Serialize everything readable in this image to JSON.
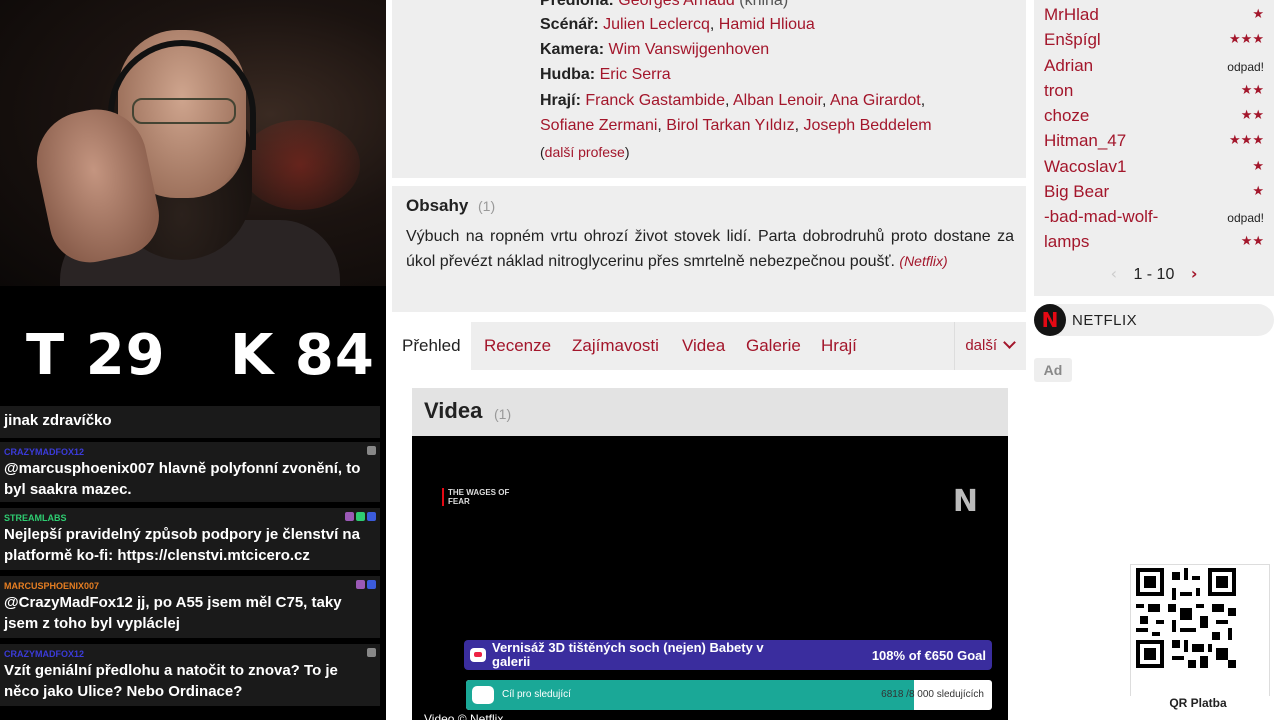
{
  "stream": {
    "score_t": "T 29",
    "score_k": "K 84",
    "chat": [
      {
        "user": "",
        "user_color": "#9b9b9b",
        "text": "jinak zdravíčko"
      },
      {
        "user": "CRAZYMADFOX12",
        "user_color": "#3b3bd9",
        "text": "@marcusphoenix007 hlavně polyfonní zvonění, to byl saakra mazec."
      },
      {
        "user": "STREAMLABS",
        "user_color": "#2ecc71",
        "text": "Nejlepší pravidelný způsob podpory je členství na platformě ko-fi: https://clenstvi.mtcicero.cz"
      },
      {
        "user": "MARCUSPHOENIX007",
        "user_color": "#e67e22",
        "text": "@CrazyMadFox12 jj, po A55 jsem měl C75, taky jsem z toho byl vypláclej"
      },
      {
        "user": "CRAZYMADFOX12",
        "user_color": "#3b3bd9",
        "text": "Vzít geniální předlohu a natočit to znova? To je něco jako Ulice? Nebo Ordinace?"
      }
    ],
    "goal": {
      "name": "Vernisáž 3D tištěných soch (nejen) Babety v galerii",
      "progress": "108% of €650 Goal",
      "progress_fraction": 1.0
    },
    "followers": {
      "label": "Cíl pro sledující",
      "count": "6818 /8 000 sledujících",
      "progress_fraction": 0.852
    }
  },
  "film": {
    "credits": [
      {
        "label": "Předloha:",
        "people": [
          "Georges Arnaud"
        ],
        "suffix": "(kniha)"
      },
      {
        "label": "Scénář:",
        "people": [
          "Julien Leclercq",
          "Hamid Hlioua"
        ]
      },
      {
        "label": "Kamera:",
        "people": [
          "Wim Vanswijgenhoven"
        ]
      },
      {
        "label": "Hudba:",
        "people": [
          "Eric Serra"
        ]
      },
      {
        "label": "Hrají:",
        "people": [
          "Franck Gastambide",
          "Alban Lenoir",
          "Ana Girardot"
        ]
      },
      {
        "label": "",
        "people": [
          "Sofiane Zermani",
          "Birol Tarkan Yıldız",
          "Joseph Beddelem"
        ]
      }
    ],
    "more_professions": "další profese",
    "obsahy": {
      "title": "Obsahy",
      "count": "(1)",
      "text": "Výbuch na ropném vrtu ohrozí život stovek lidí. Parta dobrodruhů proto dostane za úkol převézt náklad nitroglycerinu přes smrtelně nebezpečnou poušť.",
      "source": "(Netflix)"
    },
    "tabs": [
      {
        "label": "Přehled"
      },
      {
        "label": "Recenze"
      },
      {
        "label": "Zajímavosti"
      },
      {
        "label": "Videa"
      },
      {
        "label": "Galerie"
      },
      {
        "label": "Hrají"
      }
    ],
    "tab_more": "další",
    "videa": {
      "title": "Videa",
      "count": "(1)",
      "video_logo": "THE WAGES OF FEAR",
      "video_brand": "N",
      "credit": "Video © Netflix"
    }
  },
  "sidebar": {
    "ratings": [
      {
        "user": "MrHlad",
        "stars": "★"
      },
      {
        "user": "Enšpígl",
        "stars": "★★★"
      },
      {
        "user": "Adrian",
        "odpad": "odpad!"
      },
      {
        "user": "tron",
        "stars": "★★"
      },
      {
        "user": "choze",
        "stars": "★★"
      },
      {
        "user": "Hitman_47",
        "stars": "★★★"
      },
      {
        "user": "Wacoslav1",
        "stars": "★"
      },
      {
        "user": "Big Bear",
        "stars": "★"
      },
      {
        "user": "-bad-mad-wolf-",
        "odpad": "odpad!"
      },
      {
        "user": "lamps",
        "stars": "★★"
      }
    ],
    "pager": {
      "range": "1 - 10",
      "prev": "‹",
      "next": "›"
    },
    "vod": {
      "logo": "N",
      "label": "NETFLIX"
    },
    "ad": "Ad",
    "qr_label": "QR Platba"
  },
  "colors": {
    "accent": "#a3162b",
    "panel": "#eeeeee",
    "goal_bg": "#3a2d9e",
    "follower_fill": "#1aa897"
  }
}
